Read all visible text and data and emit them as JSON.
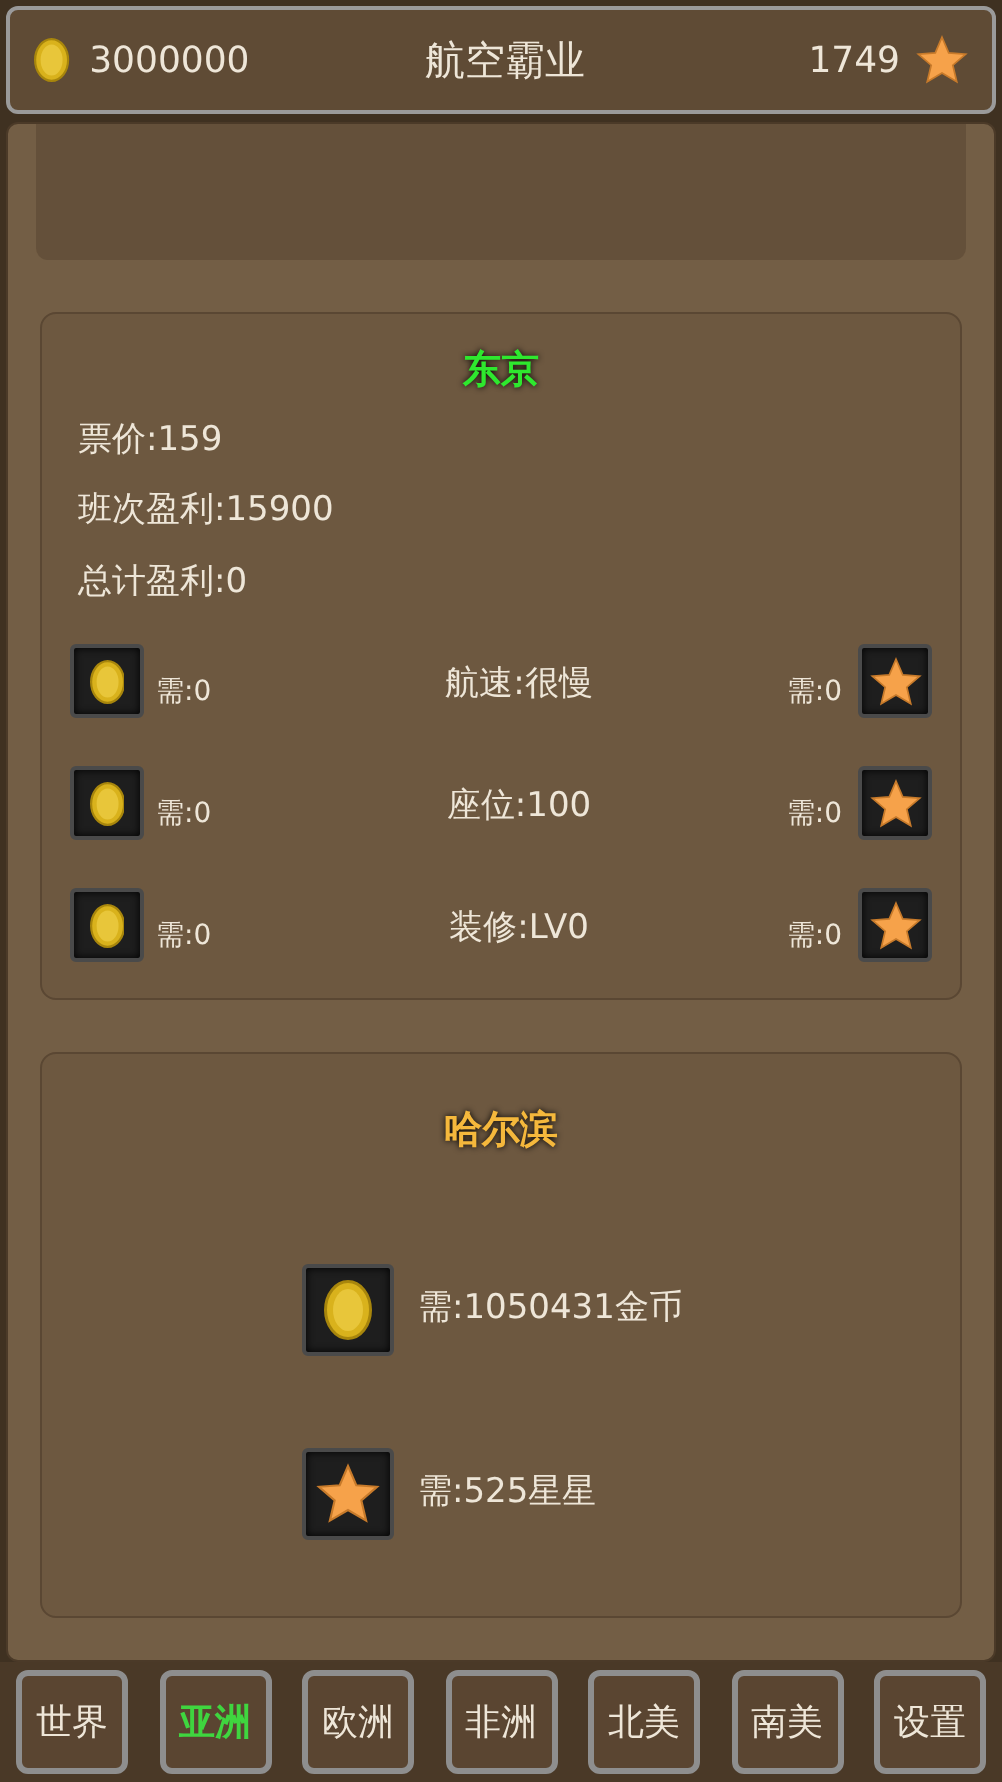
{
  "header": {
    "coins": "3000000",
    "title": "航空霸业",
    "stars": "1749"
  },
  "cities": [
    {
      "kind": "owned",
      "name": "东京",
      "color": "#2ee82e",
      "stats": [
        "票价:159",
        "班次盈利:15900",
        "总计盈利:0"
      ],
      "upgrades": [
        {
          "coin_cost": "需:0",
          "label": "航速:很慢",
          "star_cost": "需:0"
        },
        {
          "coin_cost": "需:0",
          "label": "座位:100",
          "star_cost": "需:0"
        },
        {
          "coin_cost": "需:0",
          "label": "装修:LV0",
          "star_cost": "需:0"
        }
      ]
    },
    {
      "kind": "locked",
      "name": "哈尔滨",
      "color": "#f5b83c",
      "coin_requirement": "需:1050431金币",
      "star_requirement": "需:525星星"
    }
  ],
  "tabs": [
    {
      "label": "世界",
      "selected": false
    },
    {
      "label": "亚洲",
      "selected": true
    },
    {
      "label": "欧洲",
      "selected": false
    },
    {
      "label": "非洲",
      "selected": false
    },
    {
      "label": "北美",
      "selected": false
    },
    {
      "label": "南美",
      "selected": false
    },
    {
      "label": "设置",
      "selected": false
    }
  ]
}
